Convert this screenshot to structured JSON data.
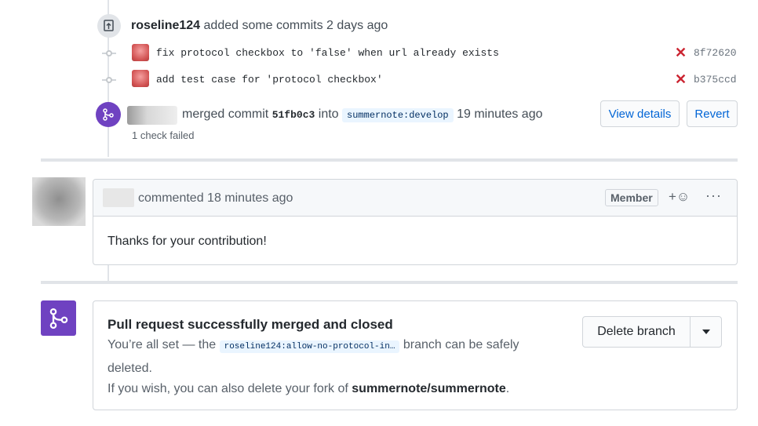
{
  "commits_event": {
    "author": "roseline124",
    "text": "added some commits 2 days ago",
    "commits": [
      {
        "message": "fix protocol checkbox to 'false' when url already exists",
        "sha": "8f72620",
        "status": "failed"
      },
      {
        "message": "add test case for 'protocol checkbox'",
        "sha": "b375ccd",
        "status": "failed"
      }
    ]
  },
  "merge_event": {
    "text_merged": "merged commit",
    "commit_sha": "51fb0c3",
    "text_into": "into",
    "branch": "summernote:develop",
    "time": "19 minutes ago",
    "check_status": "1 check failed",
    "view_details_label": "View details",
    "revert_label": "Revert"
  },
  "comment": {
    "header_text": "commented 18 minutes ago",
    "badge": "Member",
    "reaction_icon": "smiley-icon",
    "more_icon": "kebab-icon",
    "body": "Thanks for your contribution!"
  },
  "merged_box": {
    "title": "Pull request successfully merged and closed",
    "text_before": "You’re all set — the",
    "branch": "roseline124:allow-no-protocol-in…",
    "text_after": "branch can be safely",
    "text_line2": "deleted.",
    "fork_text_before": "If you wish, you can also delete your fork of",
    "fork_repo": "summernote/summernote",
    "fork_text_after": ".",
    "delete_branch_label": "Delete branch",
    "dropdown_icon": "caret-down-icon"
  },
  "colors": {
    "merged_purple": "#6f42c1",
    "link_blue": "#0366d6",
    "fail_red": "#cb2431"
  }
}
